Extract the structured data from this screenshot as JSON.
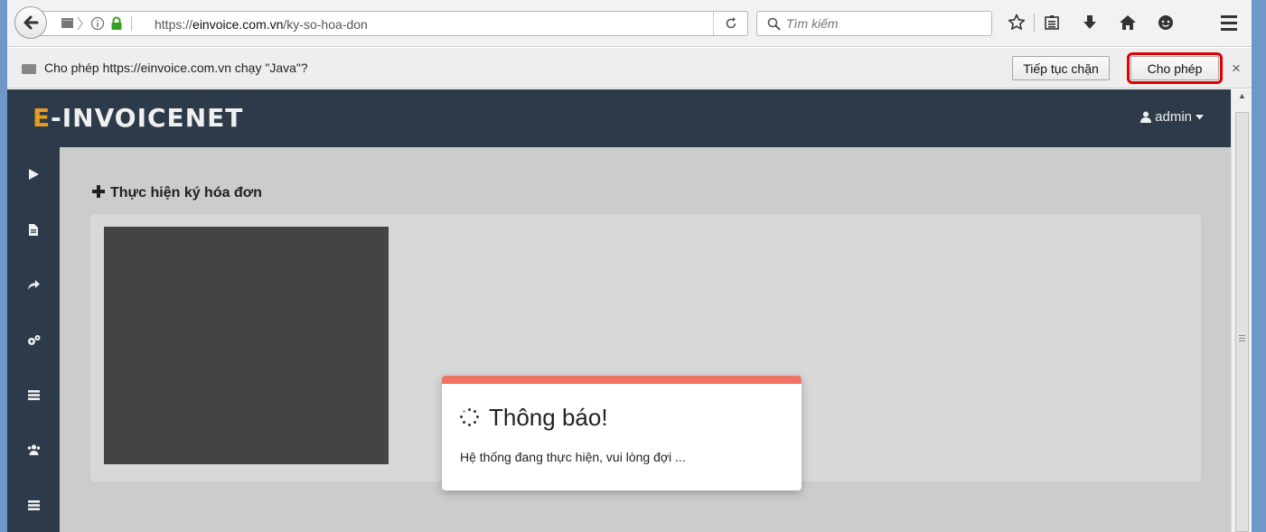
{
  "browser": {
    "url_prefix": "https://",
    "url_domain": "einvoice.com.vn",
    "url_path": "/ky-so-hoa-don",
    "search_placeholder": "Tìm kiếm"
  },
  "plugin_bar": {
    "message": "Cho phép https://einvoice.com.vn chạy \"Java\"?",
    "block_label": "Tiếp tục chặn",
    "allow_label": "Cho phép",
    "close_symbol": "×"
  },
  "app": {
    "logo_lead": "E",
    "logo_rest": "-INVOICENET",
    "user": "admin",
    "sidebar_icons": [
      "play-icon",
      "document-icon",
      "share-icon",
      "gears-icon",
      "list-icon",
      "users-icon",
      "list-icon"
    ]
  },
  "main": {
    "section_title": "Thực hiện ký hóa đơn"
  },
  "modal": {
    "title": "Thông báo!",
    "message": "Hệ thống đang thực hiện, vui lòng đợi ..."
  },
  "colors": {
    "header_bg": "#2f3e4e",
    "logo_accent": "#f5a623",
    "modal_accent": "#ef7466",
    "allow_highlight": "#e00000"
  }
}
